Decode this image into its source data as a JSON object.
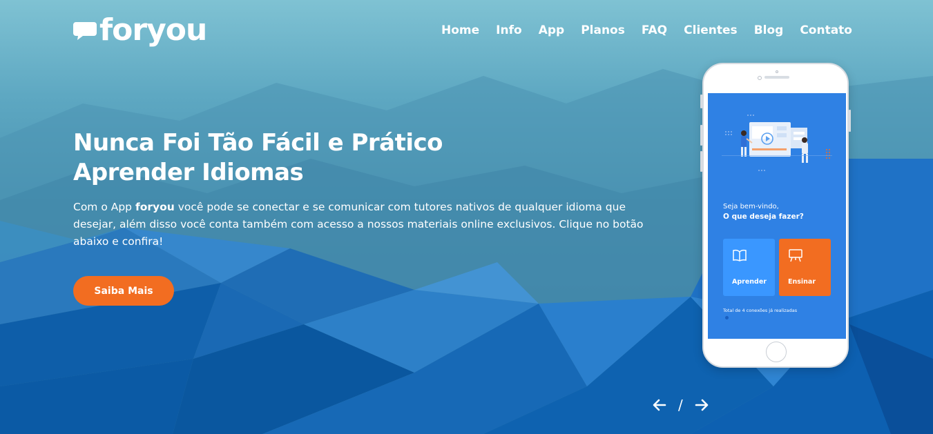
{
  "brand": {
    "logo_text": "foryou"
  },
  "nav": {
    "items": [
      {
        "label": "Home"
      },
      {
        "label": "Info"
      },
      {
        "label": "App"
      },
      {
        "label": "Planos"
      },
      {
        "label": "FAQ"
      },
      {
        "label": "Clientes"
      },
      {
        "label": "Blog"
      },
      {
        "label": "Contato"
      }
    ]
  },
  "hero": {
    "title_line1": "Nunca Foi Tão Fácil e Prático",
    "title_line2": "Aprender Idiomas",
    "text_prefix": "Com o App ",
    "text_brand": "foryou",
    "text_suffix": " você pode se conectar e se comunicar com tutores nativos de qualquer idioma que desejar, além disso você conta também com acesso a nossos materiais online exclusivos. Clique no botão abaixo e confira!",
    "cta_label": "Saiba Mais"
  },
  "slider": {
    "separator": "/",
    "prev_icon": "arrow-left-icon",
    "next_icon": "arrow-right-icon"
  },
  "phone_screen": {
    "greeting": "Seja bem-vindo,",
    "question": "O que deseja fazer?",
    "learn_label": "Aprender",
    "teach_label": "Ensinar",
    "total_text": "Total de 4 conexões já realizadas"
  },
  "colors": {
    "accent": "#f26d21",
    "screen_blue": "#2f81e4",
    "card_blue": "#3a97ff"
  }
}
